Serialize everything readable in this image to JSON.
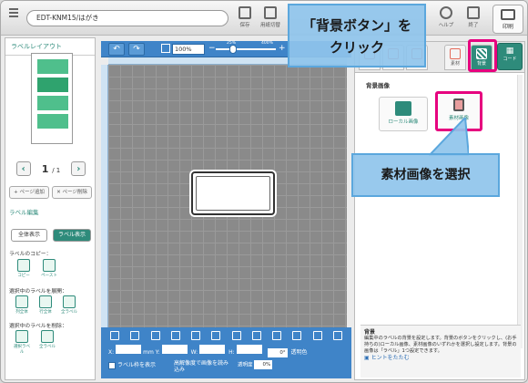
{
  "toolbar": {
    "filename": "EDT-KNM15/はがき",
    "tools": [
      {
        "label": "保存",
        "icon": "save-icon"
      },
      {
        "label": "用紙切替",
        "icon": "paper-switch-icon"
      },
      {
        "label": "ヘルプ",
        "icon": "help-icon"
      },
      {
        "label": "終了",
        "icon": "exit-icon"
      }
    ],
    "print_label": "印刷"
  },
  "left": {
    "title": "ラベルレイアウト",
    "page_current": "1",
    "page_total": "/ 1",
    "prev": "‹",
    "next": "›",
    "add_page": "+ ページ追加",
    "delete_page": "✕ ページ削除",
    "label_edit": "ラベル編集",
    "show_all": "全体表示",
    "show_label": "ラベル表示",
    "copy_heading": "ラベルのコピー：",
    "copy": "コピー",
    "paste": "ペースト",
    "select_heading": "選択中のラベルを展開：",
    "expand_all": "列全体",
    "expand_row": "行全体",
    "expand_all_labels": "全ラベル",
    "delete_heading": "選択中のラベルを削除：",
    "delete_selected": "選択ラベル",
    "delete_all": "全ラベル"
  },
  "canvas": {
    "undo": "↶",
    "redo": "↷",
    "zoom": "100%",
    "zoom_min": "25%",
    "zoom_max": "400%",
    "zoom_level_fraction": 0.29,
    "x_label": "X:",
    "x_unit": "mm",
    "y_label": "Y:",
    "w_label": "W:",
    "h_label": "H:",
    "angle": "0°",
    "transparent_color": "透明色",
    "show_frame": "ラベル枠を表示",
    "high_res": "高解像度で画像を読み込み",
    "transparency": "透明度",
    "transparency_value": "0%"
  },
  "right": {
    "tab_material": "素材",
    "tab_background": "背景",
    "tab_barcode": "コード",
    "section": "背景画像",
    "local_image": "ローカル画像",
    "material_image": "素材画像",
    "hint_title": "背景",
    "hint_text": "編集中のラベルの背景を設定します。背景のボタンをクリックし、(お手持ちの)ローカル画像、素材画像のいずれかを選択し設定します。背景の画像は「ラベル」1つ設定できます。",
    "hint_link": "ヒントをたたむ"
  },
  "callouts": {
    "step1_line1": "「背景ボタン」を",
    "step1_line2": "クリック",
    "step2": "素材画像を選択"
  },
  "colors": {
    "accent": "#2e8b7b",
    "toolbar_blue": "#3f84c8",
    "highlight": "#e6007e",
    "callout": "#8fc4ec"
  }
}
